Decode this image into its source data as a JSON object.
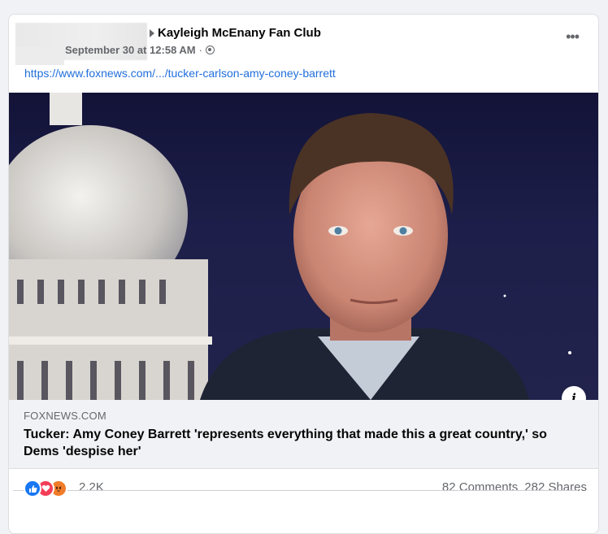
{
  "post": {
    "group_name": "Kayleigh McEnany Fan Club",
    "timestamp": "September 30 at 12:58 AM",
    "separator": "·",
    "privacy_icon": "globe-icon",
    "more_label": "•••",
    "link_text": "https://www.foxnews.com/.../tucker-carlson-amy-coney-barrett"
  },
  "preview": {
    "domain": "FOXNEWS.COM",
    "headline": "Tucker: Amy Coney Barrett 'represents everything that made this a great country,' so Dems 'despise her'",
    "info_label": "i"
  },
  "engagement": {
    "reaction_icons": [
      "like-icon",
      "love-icon",
      "angry-icon"
    ],
    "reaction_count": "2.2K",
    "comments": "82 Comments",
    "shares": "282 Shares"
  },
  "colors": {
    "link": "#216fdb",
    "like": "#1877f2",
    "love": "#f33e58",
    "angry": "#f07c2a"
  }
}
